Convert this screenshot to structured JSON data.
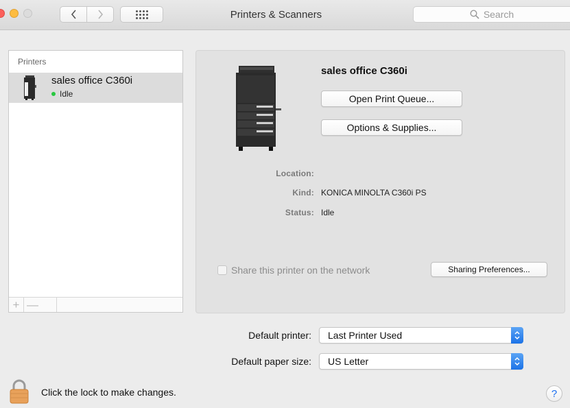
{
  "window": {
    "title": "Printers & Scanners",
    "nav_back": "<",
    "nav_forward": ">"
  },
  "search": {
    "placeholder": "Search"
  },
  "printers_list": {
    "header": "Printers",
    "items": [
      {
        "name": "sales office C360i",
        "status": "Idle",
        "status_color": "#28c840",
        "icon": "printer-icon"
      }
    ],
    "add_label": "+",
    "remove_label": "—"
  },
  "detail": {
    "name": "sales office C360i",
    "open_queue_label": "Open Print Queue...",
    "options_label": "Options & Supplies...",
    "location_label": "Location:",
    "location_value": "",
    "kind_label": "Kind:",
    "kind_value": "KONICA MINOLTA C360i PS",
    "status_label": "Status:",
    "status_value": "Idle",
    "share_label": "Share this printer on the network",
    "share_checked": false,
    "sharing_prefs_label": "Sharing Preferences..."
  },
  "defaults": {
    "printer_label": "Default printer:",
    "printer_value": "Last Printer Used",
    "paper_label": "Default paper size:",
    "paper_value": "US Letter"
  },
  "footer": {
    "lock_text": "Click the lock to make changes.",
    "help_label": "?"
  },
  "colors": {
    "accent": "#1c73e7",
    "idle_dot": "#28c840",
    "lock": "#e8a15a"
  }
}
